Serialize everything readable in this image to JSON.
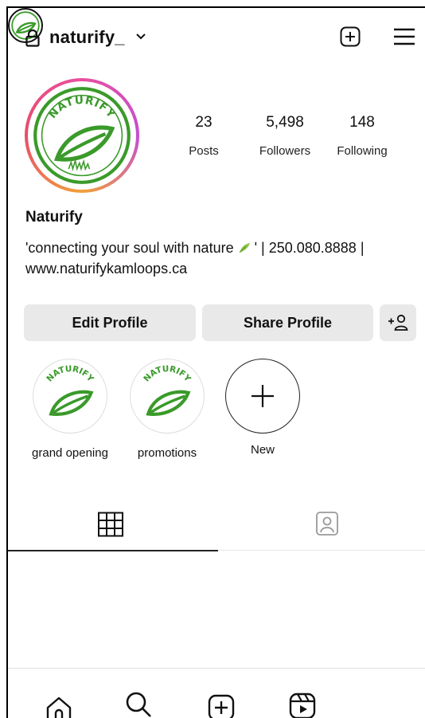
{
  "header": {
    "username": "naturify_",
    "icons": {
      "lock": "lock-icon",
      "chevron": "chevron-down-icon",
      "create": "plus-square-icon",
      "menu": "hamburger-menu-icon"
    }
  },
  "profile": {
    "avatar": {
      "icon": "naturify-logo",
      "text": "NATURIFY"
    },
    "stats": [
      {
        "value": "23",
        "label": "Posts"
      },
      {
        "value": "5,498",
        "label": "Followers"
      },
      {
        "value": "148",
        "label": "Following"
      }
    ],
    "name": "Naturify",
    "bio_before": "'connecting your soul with nature ",
    "bio_after": " ' | 250.080.8888 | www.naturifykamloops.ca"
  },
  "actions": {
    "edit_profile": "Edit Profile",
    "share_profile": "Share Profile",
    "add_person_icon": "add-person-icon"
  },
  "highlights": [
    {
      "label": "grand opening"
    },
    {
      "label": "promotions"
    },
    {
      "label": "New"
    }
  ],
  "tabs": {
    "active": "grid",
    "icons": [
      "grid-icon",
      "tagged-icon"
    ]
  },
  "bottom_nav": {
    "icons": [
      "home-icon",
      "search-icon",
      "create-icon",
      "reels-icon",
      "profile-avatar"
    ]
  },
  "colors": {
    "leaf_green": "#3a9a2a",
    "ring_pink": "#e94fa0",
    "button_bg": "#e9e9e9"
  }
}
